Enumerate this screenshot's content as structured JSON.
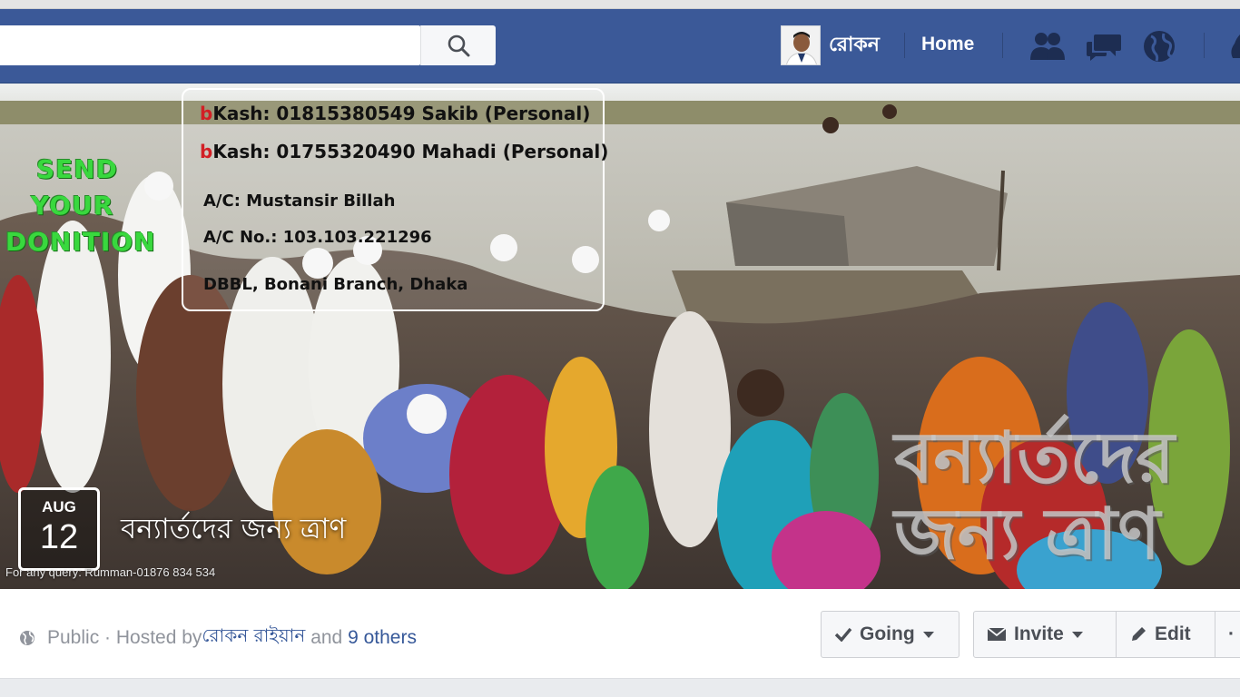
{
  "header": {
    "search_placeholder": "",
    "profile_name": "রোকন",
    "home_label": "Home"
  },
  "cover": {
    "info_lines": [
      {
        "prefix": "b",
        "text": "Kash: 01815380549  Sakib (Personal)"
      },
      {
        "prefix": "b",
        "text": "Kash: 01755320490  Mahadi (Personal)"
      }
    ],
    "account_name": "A/C: Mustansir Billah",
    "account_no": "A/C No.: 103.103.221296",
    "bank": "DBBL, Bonani Branch, Dhaka",
    "send_text": [
      "SEND",
      "YOUR",
      "DONITION"
    ],
    "watermark_lines": [
      "বন্যার্তদের",
      "জন্য ত্রাণ"
    ],
    "query_text": "For any query:  Rumman-01876 834 534"
  },
  "event": {
    "month": "AUG",
    "day": "12",
    "title": "বন্যার্তদের জন্য ত্রাণ"
  },
  "info_bar": {
    "privacy": "Public · Hosted by ",
    "host": "রোকন রাইয়ান",
    "and_text": " and ",
    "others": "9 others",
    "going_label": "Going",
    "invite_label": "Invite",
    "edit_label": "Edit",
    "more_label": "·"
  },
  "colors": {
    "fb_blue": "#3b5998",
    "link_blue": "#365899",
    "bkash_red": "#d21f25",
    "green_text": "#39d83e"
  }
}
